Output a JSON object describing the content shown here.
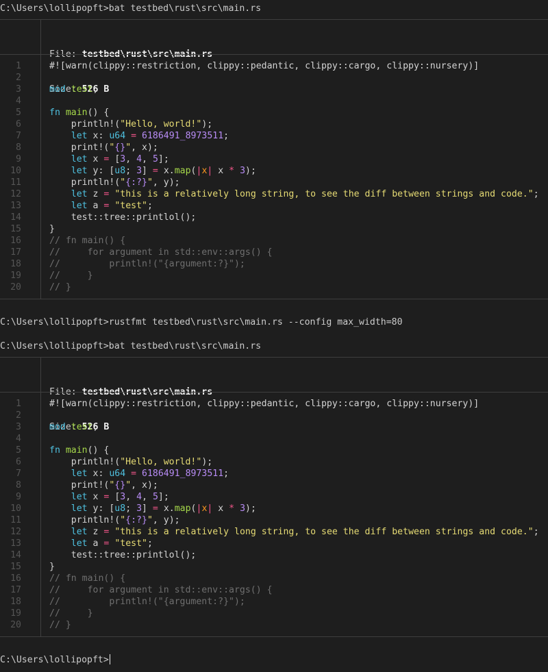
{
  "commands": {
    "bat1": "C:\\Users\\lollipopft>bat testbed\\rust\\src\\main.rs",
    "rustfmt": "C:\\Users\\lollipopft>rustfmt testbed\\rust\\src\\main.rs --config max_width=80",
    "bat2": "C:\\Users\\lollipopft>bat testbed\\rust\\src\\main.rs",
    "final_prompt": "C:\\Users\\lollipopft>"
  },
  "file_header": {
    "file_label": "File: ",
    "file_value": "testbed\\rust\\src\\main.rs",
    "size_label": "Size: ",
    "size_value": "526 B"
  },
  "line_numbers": [
    "1",
    "2",
    "3",
    "4",
    "5",
    "6",
    "7",
    "8",
    "9",
    "10",
    "11",
    "12",
    "13",
    "14",
    "15",
    "16",
    "17",
    "18",
    "19",
    "20"
  ],
  "code_lines": [
    [
      [
        "#![warn(clippy::restriction, clippy::pedantic, clippy::cargo, clippy::nursery)]",
        "plain"
      ]
    ],
    [],
    [
      [
        "mod",
        "kw"
      ],
      [
        " ",
        "plain"
      ],
      [
        "test",
        "fn"
      ],
      [
        ";",
        "plain"
      ]
    ],
    [],
    [
      [
        "fn",
        "kw"
      ],
      [
        " ",
        "plain"
      ],
      [
        "main",
        "fn"
      ],
      [
        "() {",
        "plain"
      ]
    ],
    [
      [
        "    println!(",
        "plain"
      ],
      [
        "\"Hello, world!\"",
        "str"
      ],
      [
        ");",
        "plain"
      ]
    ],
    [
      [
        "    ",
        "plain"
      ],
      [
        "let",
        "kw"
      ],
      [
        " x: ",
        "plain"
      ],
      [
        "u64",
        "ty"
      ],
      [
        " ",
        "plain"
      ],
      [
        "=",
        "op"
      ],
      [
        " ",
        "plain"
      ],
      [
        "6186491_8973511",
        "num"
      ],
      [
        ";",
        "plain"
      ]
    ],
    [
      [
        "    print!(",
        "plain"
      ],
      [
        "\"",
        "str"
      ],
      [
        "{}",
        "num"
      ],
      [
        "\"",
        "str"
      ],
      [
        ", x);",
        "plain"
      ]
    ],
    [
      [
        "    ",
        "plain"
      ],
      [
        "let",
        "kw"
      ],
      [
        " x ",
        "plain"
      ],
      [
        "=",
        "op"
      ],
      [
        " [",
        "plain"
      ],
      [
        "3",
        "num"
      ],
      [
        ", ",
        "plain"
      ],
      [
        "4",
        "num"
      ],
      [
        ", ",
        "plain"
      ],
      [
        "5",
        "num"
      ],
      [
        "];",
        "plain"
      ]
    ],
    [
      [
        "    ",
        "plain"
      ],
      [
        "let",
        "kw"
      ],
      [
        " y: [",
        "plain"
      ],
      [
        "u8",
        "ty"
      ],
      [
        "; ",
        "plain"
      ],
      [
        "3",
        "num"
      ],
      [
        "] ",
        "plain"
      ],
      [
        "=",
        "op"
      ],
      [
        " x.",
        "plain"
      ],
      [
        "map",
        "fn"
      ],
      [
        "(",
        "plain"
      ],
      [
        "|",
        "op"
      ],
      [
        "x",
        "arg"
      ],
      [
        "|",
        "op"
      ],
      [
        " x ",
        "plain"
      ],
      [
        "*",
        "op"
      ],
      [
        " ",
        "plain"
      ],
      [
        "3",
        "num"
      ],
      [
        ");",
        "plain"
      ]
    ],
    [
      [
        "    println!(",
        "plain"
      ],
      [
        "\"",
        "str"
      ],
      [
        "{:?}",
        "num"
      ],
      [
        "\"",
        "str"
      ],
      [
        ", y);",
        "plain"
      ]
    ],
    [
      [
        "    ",
        "plain"
      ],
      [
        "let",
        "kw"
      ],
      [
        " z ",
        "plain"
      ],
      [
        "=",
        "op"
      ],
      [
        " ",
        "plain"
      ],
      [
        "\"this is a relatively long string, to see the diff between strings and code.\"",
        "str"
      ],
      [
        ";",
        "plain"
      ]
    ],
    [
      [
        "    ",
        "plain"
      ],
      [
        "let",
        "kw"
      ],
      [
        " a ",
        "plain"
      ],
      [
        "=",
        "op"
      ],
      [
        " ",
        "plain"
      ],
      [
        "\"test\"",
        "str"
      ],
      [
        ";",
        "plain"
      ]
    ],
    [
      [
        "    test::tree::printlol();",
        "plain"
      ]
    ],
    [
      [
        "}",
        "plain"
      ]
    ],
    [
      [
        "// fn main() {",
        "cm"
      ]
    ],
    [
      [
        "//     for argument in std::env::args() {",
        "cm"
      ]
    ],
    [
      [
        "//         println!(\"{argument:?}\");",
        "cm"
      ]
    ],
    [
      [
        "//     }",
        "cm"
      ]
    ],
    [
      [
        "// }",
        "cm"
      ]
    ]
  ],
  "colors": {
    "background": "#1e1e1e",
    "keyword": "#4fc1e0",
    "function": "#a6d84a",
    "string": "#e6db74",
    "number": "#b88cf5",
    "operator": "#f2558a",
    "comment": "#6f6f6f"
  }
}
